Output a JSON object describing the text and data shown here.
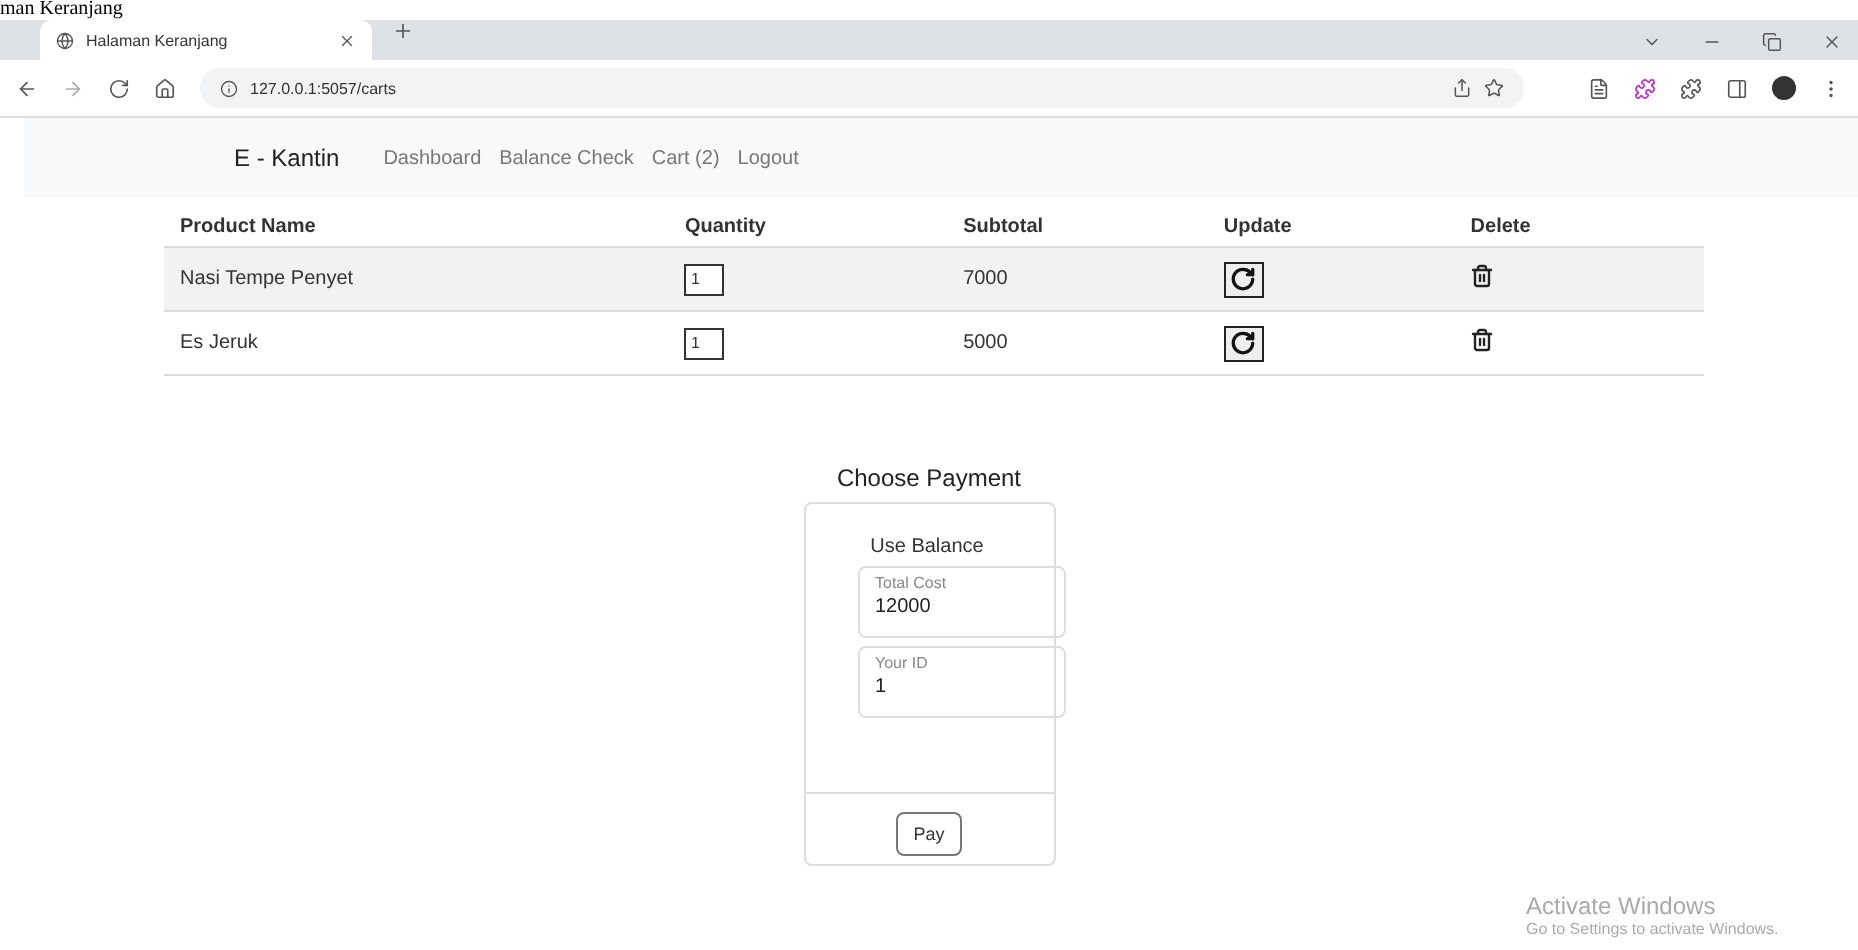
{
  "heading_fragment": "man Keranjang",
  "browser": {
    "tab_title": "Halaman Keranjang",
    "url": "127.0.0.1:5057/carts"
  },
  "navbar": {
    "brand": "E - Kantin",
    "links": [
      {
        "label": "Dashboard"
      },
      {
        "label": "Balance Check"
      },
      {
        "label": "Cart (2)"
      },
      {
        "label": "Logout"
      }
    ]
  },
  "table": {
    "columns": [
      "Product Name",
      "Quantity",
      "Subtotal",
      "Update",
      "Delete"
    ],
    "rows": [
      {
        "product": "Nasi Tempe Penyet",
        "quantity": "1",
        "subtotal": "7000"
      },
      {
        "product": "Es Jeruk",
        "quantity": "1",
        "subtotal": "5000"
      }
    ]
  },
  "payment": {
    "title": "Choose Payment",
    "method": "Use Balance",
    "fields": [
      {
        "label": "Total Cost",
        "value": "12000"
      },
      {
        "label": "Your ID",
        "value": "1"
      }
    ],
    "button": "Pay"
  },
  "os_notice": {
    "title": "Activate Windows",
    "text": "Go to Settings to activate Windows."
  }
}
